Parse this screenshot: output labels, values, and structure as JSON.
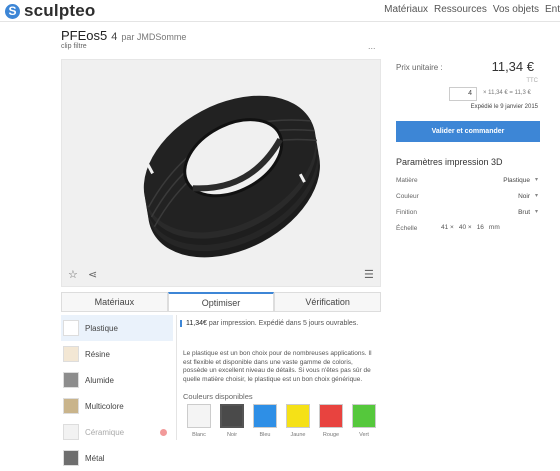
{
  "brand": {
    "name": "sculpteo",
    "mark": "S"
  },
  "nav": {
    "items": [
      "Matériaux",
      "Ressources",
      "Vos objets",
      "Ent"
    ]
  },
  "product": {
    "title": "PFEos5",
    "count": "4",
    "by": "par JMDSomme",
    "subtitle": "clip filtre",
    "more": "..."
  },
  "viewer": {
    "star_icon": "star-icon",
    "share_icon": "share-icon",
    "settings_icon": "sliders-icon"
  },
  "tabs": [
    "Matériaux",
    "Optimiser",
    "Vérification"
  ],
  "materials": [
    {
      "label": "Plastique",
      "color": "#ffffff",
      "selected": true
    },
    {
      "label": "Résine",
      "color": "#f3e7d4"
    },
    {
      "label": "Alumide",
      "color": "#8d8d8d"
    },
    {
      "label": "Multicolore",
      "color": "#c9b48b"
    },
    {
      "label": "Céramique",
      "color": "#f2f2f2",
      "disabled": true
    },
    {
      "label": "Métal",
      "color": "#6e6e6e"
    }
  ],
  "detail": {
    "price": "11,34€",
    "price_suffix": "par impression. Expédié dans 5 jours ouvrables.",
    "description": "Le plastique est un bon choix pour de nombreuses applications. Il est flexible et disponible dans une vaste gamme de coloris, possède un excellent niveau de détails. Si vous n'êtes pas sûr de quelle matière choisir, le plastique est un bon choix générique.",
    "colors_title": "Couleurs disponibles",
    "colors": [
      {
        "name": "Blanc",
        "hex": "#f4f4f4"
      },
      {
        "name": "Noir",
        "hex": "#4a4a4a",
        "selected": true
      },
      {
        "name": "Bleu",
        "hex": "#2e8fe6"
      },
      {
        "name": "Jaune",
        "hex": "#f5e117"
      },
      {
        "name": "Rouge",
        "hex": "#e8433f"
      },
      {
        "name": "Vert",
        "hex": "#55c83c"
      }
    ]
  },
  "order": {
    "unit_label": "Prix unitaire :",
    "unit_price": "11,34 €",
    "tax_note": "TTC",
    "quantity": "4",
    "quantity_calc": "× 11,34 € = 11,3 €",
    "shipping": "Expédié le 9 janvier 2015",
    "cta": "Valider et commander"
  },
  "params": {
    "title": "Paramètres impression 3D",
    "rows": [
      {
        "label": "Matière",
        "value": "Plastique"
      },
      {
        "label": "Couleur",
        "value": "Noir"
      },
      {
        "label": "Finition",
        "value": "Brut"
      }
    ],
    "scale": {
      "label": "Échelle",
      "x": "41 ×",
      "y": "40 ×",
      "z": "16",
      "unit": "mm"
    }
  }
}
